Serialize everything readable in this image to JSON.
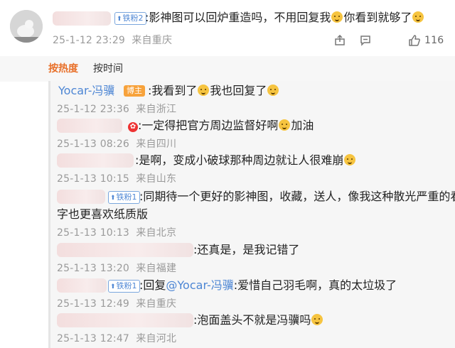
{
  "top_comment": {
    "badge": "铁粉2",
    "text_a": ":影神图可以回炉重造吗，不用回复我",
    "text_b": "你看到就够了",
    "date": "25-1-12 23:29",
    "location": "来自重庆",
    "like_count": "116"
  },
  "sort_tabs": {
    "hot": "按热度",
    "time": "按时间"
  },
  "replies": [
    {
      "author": "Yocar-冯骥",
      "owner_badge": "博主",
      "text_a": ":我看到了",
      "text_b": "我也回复了",
      "date": "25-1-12 23:36",
      "location": "来自浙江"
    },
    {
      "text_a": ":一定得把官方周边监督好啊",
      "text_b": "加油",
      "date": "25-1-13 08:26",
      "location": "来自四川"
    },
    {
      "text_a": ":是啊，变成小破球那种周边就让人很难崩",
      "date": "25-1-13 10:15",
      "location": "来自山东"
    },
    {
      "badge": "铁粉1",
      "text_a": ":同期待一个更好的影神图，收藏，送人，像我这种散光严重的看文",
      "text_b": "字也更喜欢纸质版",
      "date": "25-1-13 10:13",
      "location": "来自北京"
    },
    {
      "text_a": ":还真是，是我记错了",
      "date": "25-1-13 13:20",
      "location": "来自福建"
    },
    {
      "badge": "铁粉1",
      "text_a": ":回复",
      "mention": "@Yocar-冯骥",
      "text_b": ":爱惜自己羽毛啊，真的太垃圾了",
      "date": "25-1-13 12:49",
      "location": "来自重庆"
    },
    {
      "text_a": ":泡面盖头不就是冯骥吗",
      "date": "25-1-13 12:47",
      "location": "来自河北"
    }
  ],
  "icons": {
    "share": "share-icon",
    "comment": "comment-icon",
    "like": "thumbs-up-icon",
    "level": "level-up-icon",
    "emoji": "cat-face-emoji-icon"
  },
  "colors": {
    "accent": "#e8702a",
    "link": "#4d86d4",
    "owner_badge": "#f7a23b"
  }
}
